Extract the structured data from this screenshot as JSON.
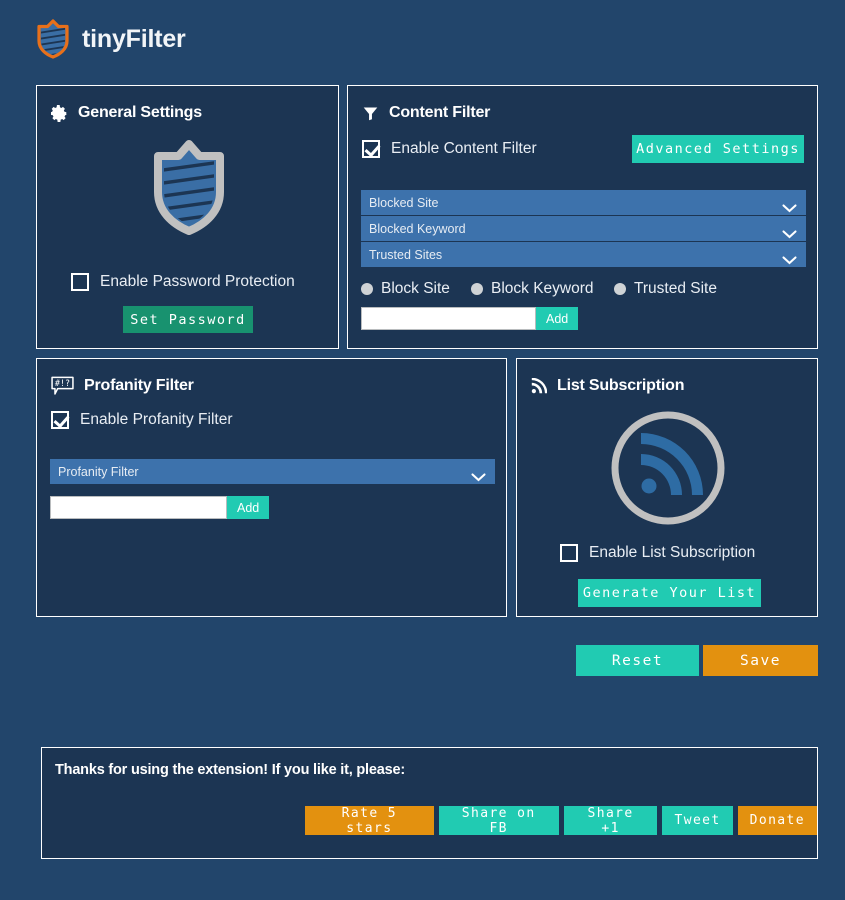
{
  "header": {
    "title": "tinyFilter",
    "logo_icon": "shield-icon"
  },
  "colors": {
    "page_background": "#22456b",
    "panel_background": "#1c3553",
    "panel_border": "#ffffff",
    "accent_teal": "#21cbb2",
    "accent_green": "#18926f",
    "accent_orange": "#e3910f",
    "select_blue": "#3d72ac",
    "shield_blue": "#3a6ea5",
    "shield_gray": "#c0c0c0"
  },
  "general_settings": {
    "title": "General Settings",
    "icon": "gear-icon",
    "shield_icon": "shield-striped-icon",
    "password_checkbox": {
      "label": "Enable Password Protection",
      "checked": false
    },
    "set_password_button": "Set Password"
  },
  "content_filter": {
    "title": "Content Filter",
    "icon": "funnel-icon",
    "enable_checkbox": {
      "label": "Enable Content Filter",
      "checked": true
    },
    "advanced_settings_button": "Advanced Settings",
    "selects": [
      {
        "label": "Blocked Site",
        "icon": "chevron-down-icon"
      },
      {
        "label": "Blocked Keyword",
        "icon": "chevron-down-icon"
      },
      {
        "label": "Trusted Sites",
        "icon": "chevron-down-icon"
      }
    ],
    "radios": [
      {
        "label": "Block Site",
        "selected": false
      },
      {
        "label": "Block Keyword",
        "selected": false
      },
      {
        "label": "Trusted Site",
        "selected": false
      }
    ],
    "input": {
      "value": "",
      "placeholder": ""
    },
    "add_button": "Add"
  },
  "profanity_filter": {
    "title": "Profanity Filter",
    "icon": "speech-bubble-profanity-icon",
    "enable_checkbox": {
      "label": "Enable Profanity Filter",
      "checked": true
    },
    "select": {
      "label": "Profanity Filter",
      "icon": "chevron-down-icon"
    },
    "input": {
      "value": "",
      "placeholder": ""
    },
    "add_button": "Add"
  },
  "list_subscription": {
    "title": "List Subscription",
    "icon": "rss-icon",
    "logo_icon": "rss-circle-icon",
    "enable_checkbox": {
      "label": "Enable List Subscription",
      "checked": false
    },
    "generate_button": "Generate Your List"
  },
  "actions": {
    "reset_button": "Reset",
    "save_button": "Save"
  },
  "footer": {
    "message": "Thanks for using the extension! If you like it, please:",
    "buttons": [
      {
        "label": "Rate 5 stars",
        "style": "orange"
      },
      {
        "label": "Share on FB",
        "style": "teal"
      },
      {
        "label": "Share +1",
        "style": "teal"
      },
      {
        "label": "Tweet",
        "style": "teal"
      },
      {
        "label": "Donate",
        "style": "orange"
      }
    ]
  }
}
